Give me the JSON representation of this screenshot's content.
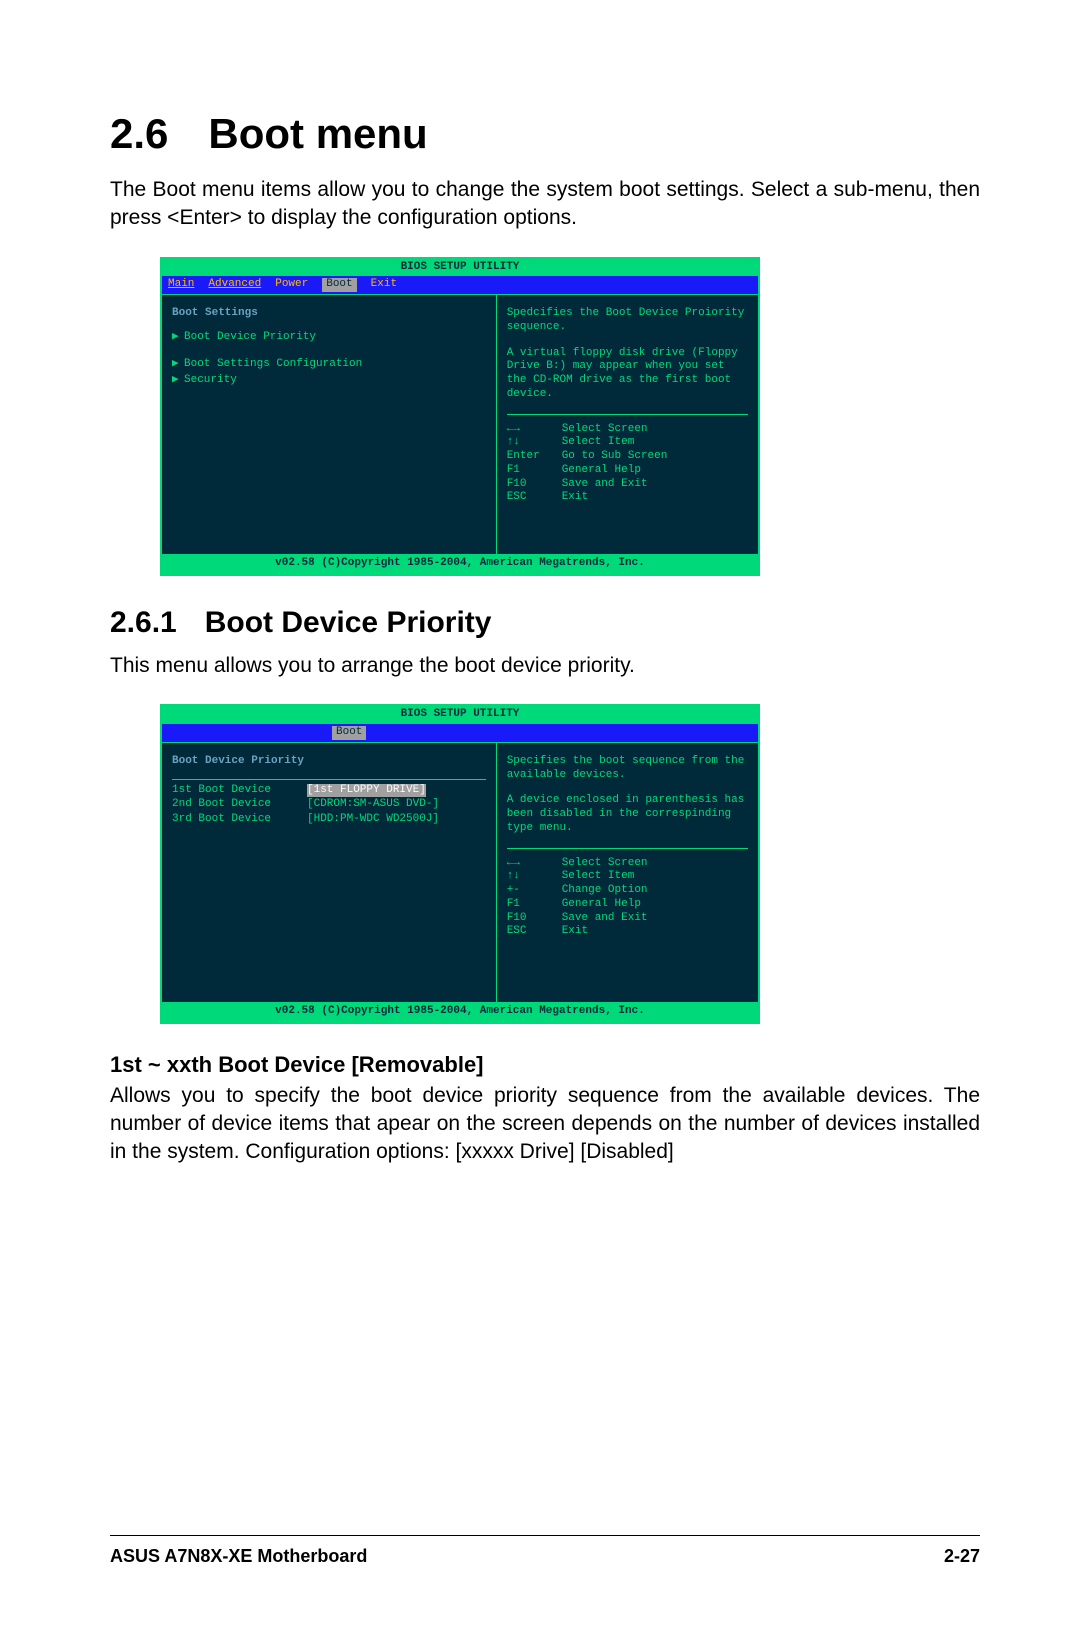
{
  "section": {
    "number": "2.6",
    "title": "Boot menu",
    "intro": "The Boot menu items allow you to change the system boot settings. Select a sub-menu, then press <Enter> to display the configuration options."
  },
  "bios1": {
    "title": "BIOS SETUP UTILITY",
    "tabs": [
      "Main",
      "Advanced",
      "Power",
      "Boot",
      "Exit"
    ],
    "activeTab": "Boot",
    "left": {
      "heading": "Boot Settings",
      "items": [
        "Boot Device Priority",
        "Boot Settings Configuration",
        "Security"
      ]
    },
    "right": {
      "help1": "Spedcifies the Boot Device Proiority sequence.",
      "help2": "A virtual floppy disk drive (Floppy Drive B:) may appear when you set the CD-ROM drive as the first boot device.",
      "keys": [
        {
          "k": "←→",
          "v": "Select Screen"
        },
        {
          "k": "↑↓",
          "v": "Select Item"
        },
        {
          "k": "Enter",
          "v": "Go to Sub Screen"
        },
        {
          "k": "F1",
          "v": "General Help"
        },
        {
          "k": "F10",
          "v": "Save and Exit"
        },
        {
          "k": "ESC",
          "v": "Exit"
        }
      ]
    },
    "footer": "v02.58 (C)Copyright 1985-2004, American Megatrends, Inc."
  },
  "subsection": {
    "number": "2.6.1",
    "title": "Boot Device Priority",
    "intro": "This menu allows you to arrange the boot device priority."
  },
  "bios2": {
    "title": "BIOS SETUP UTILITY",
    "activeTab": "Boot",
    "left": {
      "heading": "Boot Device Priority",
      "devices": [
        {
          "label": "1st Boot Device",
          "value": "[1st FLOPPY DRIVE]",
          "selected": true
        },
        {
          "label": "2nd Boot Device",
          "value": "[CDROM:SM-ASUS DVD-]",
          "selected": false
        },
        {
          "label": "3rd Boot Device",
          "value": "[HDD:PM-WDC WD2500J]",
          "selected": false
        }
      ]
    },
    "right": {
      "help1": "Specifies the boot sequence from the available devices.",
      "help2": "A device enclosed in parenthesis has been disabled in the correspinding type menu.",
      "keys": [
        {
          "k": "←→",
          "v": "Select Screen"
        },
        {
          "k": "↑↓",
          "v": "Select Item"
        },
        {
          "k": "+-",
          "v": "Change Option"
        },
        {
          "k": "F1",
          "v": "General Help"
        },
        {
          "k": "F10",
          "v": "Save and Exit"
        },
        {
          "k": "ESC",
          "v": "Exit"
        }
      ]
    },
    "footer": "v02.58 (C)Copyright 1985-2004, American Megatrends, Inc."
  },
  "subsub": {
    "title": "1st ~ xxth Boot Device [Removable]",
    "body": "Allows you to specify the boot device priority sequence from the available devices. The number of device items that apear on the screen depends on the number of devices installed in the system. Configuration options: [xxxxx Drive] [Disabled]"
  },
  "footer": {
    "left": "ASUS A7N8X-XE Motherboard",
    "right": "2-27"
  }
}
